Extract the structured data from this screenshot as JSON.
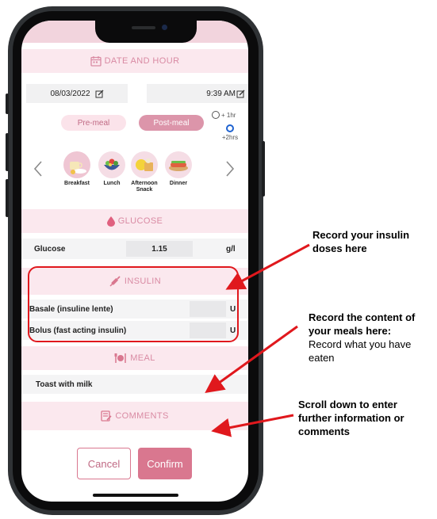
{
  "sections": {
    "date_hour": "DATE AND HOUR",
    "glucose": "GLUCOSE",
    "insulin": "INSULIN",
    "meal": "MEAL",
    "comments": "COMMENTS"
  },
  "date": "08/03/2022",
  "time": "9:39 AM",
  "meal_timing": {
    "pre": "Pre-meal",
    "post": "Post-meal",
    "option_1hr": "+ 1hr",
    "option_2hrs": "+2hrs"
  },
  "meals": [
    "Breakfast",
    "Lunch",
    "Afternoon Snack",
    "Dinner"
  ],
  "glucose": {
    "label": "Glucose",
    "value": "1.15",
    "unit": "g/l"
  },
  "insulin": {
    "basal_label": "Basale (insuline lente)",
    "bolus_label": "Bolus (fast acting insulin)",
    "unit": "U"
  },
  "meal_text": "Toast with milk",
  "buttons": {
    "cancel": "Cancel",
    "confirm": "Confirm"
  },
  "annotations": {
    "insulin_line1": "Record your insulin",
    "insulin_line2": "doses here",
    "meal_line1": "Record the content of",
    "meal_line2": "your meals here:",
    "meal_line3": "Record what you have",
    "meal_line4": "eaten",
    "scroll_line1": "Scroll down to enter",
    "scroll_line2": "further information or",
    "scroll_line3": "comments"
  },
  "colors": {
    "accent": "#d9778f",
    "section_bg": "#fbe8ee",
    "annotation_red": "#e0181d"
  }
}
